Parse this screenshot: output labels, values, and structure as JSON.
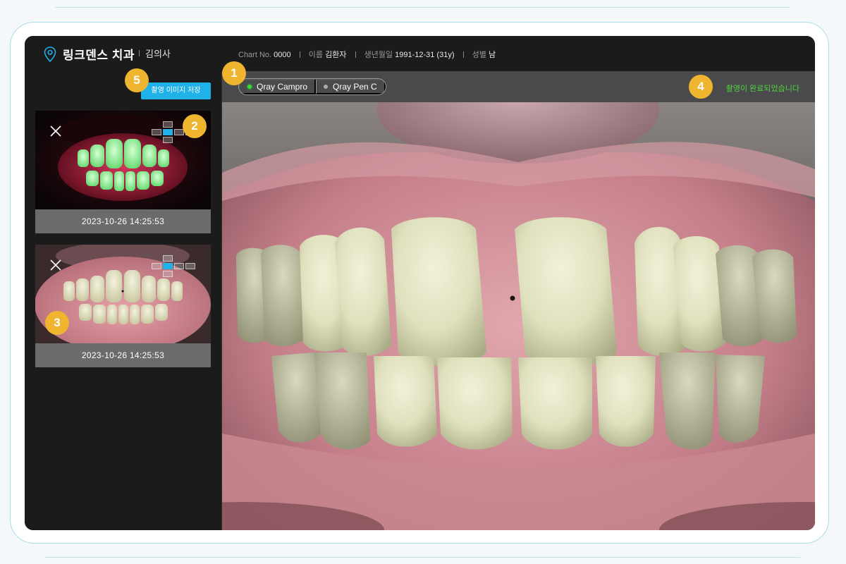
{
  "header": {
    "clinic_name": "링크덴스 치과",
    "doctor": "김의사",
    "chart_label": "Chart No.",
    "chart_no": "0000",
    "name_label": "이름",
    "name": "김환자",
    "birth_label": "생년월일",
    "birth": "1991-12-31 (31y)",
    "sex_label": "성별",
    "sex": "남"
  },
  "sidebar": {
    "save_button": "촬영 이미지 저장",
    "thumbnails": [
      {
        "timestamp": "2023-10-26   14:25:53",
        "mode": "fluorescence"
      },
      {
        "timestamp": "2023-10-26   14:25:53",
        "mode": "white-light"
      }
    ]
  },
  "toolbar": {
    "cameras": [
      {
        "label": "Qray Campro",
        "status": "active"
      },
      {
        "label": "Qray Pen C",
        "status": "inactive"
      }
    ],
    "status_message": "촬영이 완료되었습니다"
  },
  "badges": [
    "1",
    "2",
    "3",
    "4",
    "5"
  ],
  "colors": {
    "accent": "#1fb1e8",
    "badge": "#efb52f",
    "status_ok": "#4fd23d",
    "background": "#1b1b1c"
  }
}
